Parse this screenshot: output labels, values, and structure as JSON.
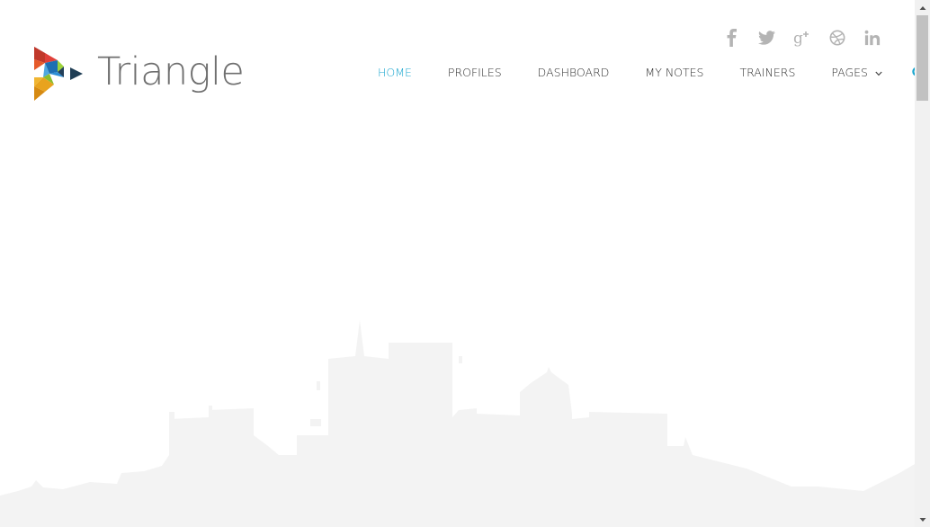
{
  "brand": {
    "name": "Triangle",
    "text_color": "#6f6f6f"
  },
  "social": [
    {
      "name": "facebook-icon"
    },
    {
      "name": "twitter-icon"
    },
    {
      "name": "google-plus-icon"
    },
    {
      "name": "dribbble-icon"
    },
    {
      "name": "linkedin-icon"
    }
  ],
  "nav": {
    "items": [
      {
        "label": "HOME",
        "active": true
      },
      {
        "label": "PROFILES",
        "active": false
      },
      {
        "label": "DASHBOARD",
        "active": false
      },
      {
        "label": "MY NOTES",
        "active": false
      },
      {
        "label": "TRAINERS",
        "active": false
      },
      {
        "label": "PAGES",
        "active": false,
        "dropdown": true
      }
    ],
    "search_icon": "search-icon",
    "active_color": "#1aa6cf",
    "text_color": "#2b2b2b"
  },
  "colors": {
    "background": "#ffffff",
    "skyline": "#f3f3f3",
    "social_icon": "#b4b4b4",
    "scrollbar_track": "#f1f1f1",
    "scrollbar_thumb": "#c1c1c1"
  }
}
